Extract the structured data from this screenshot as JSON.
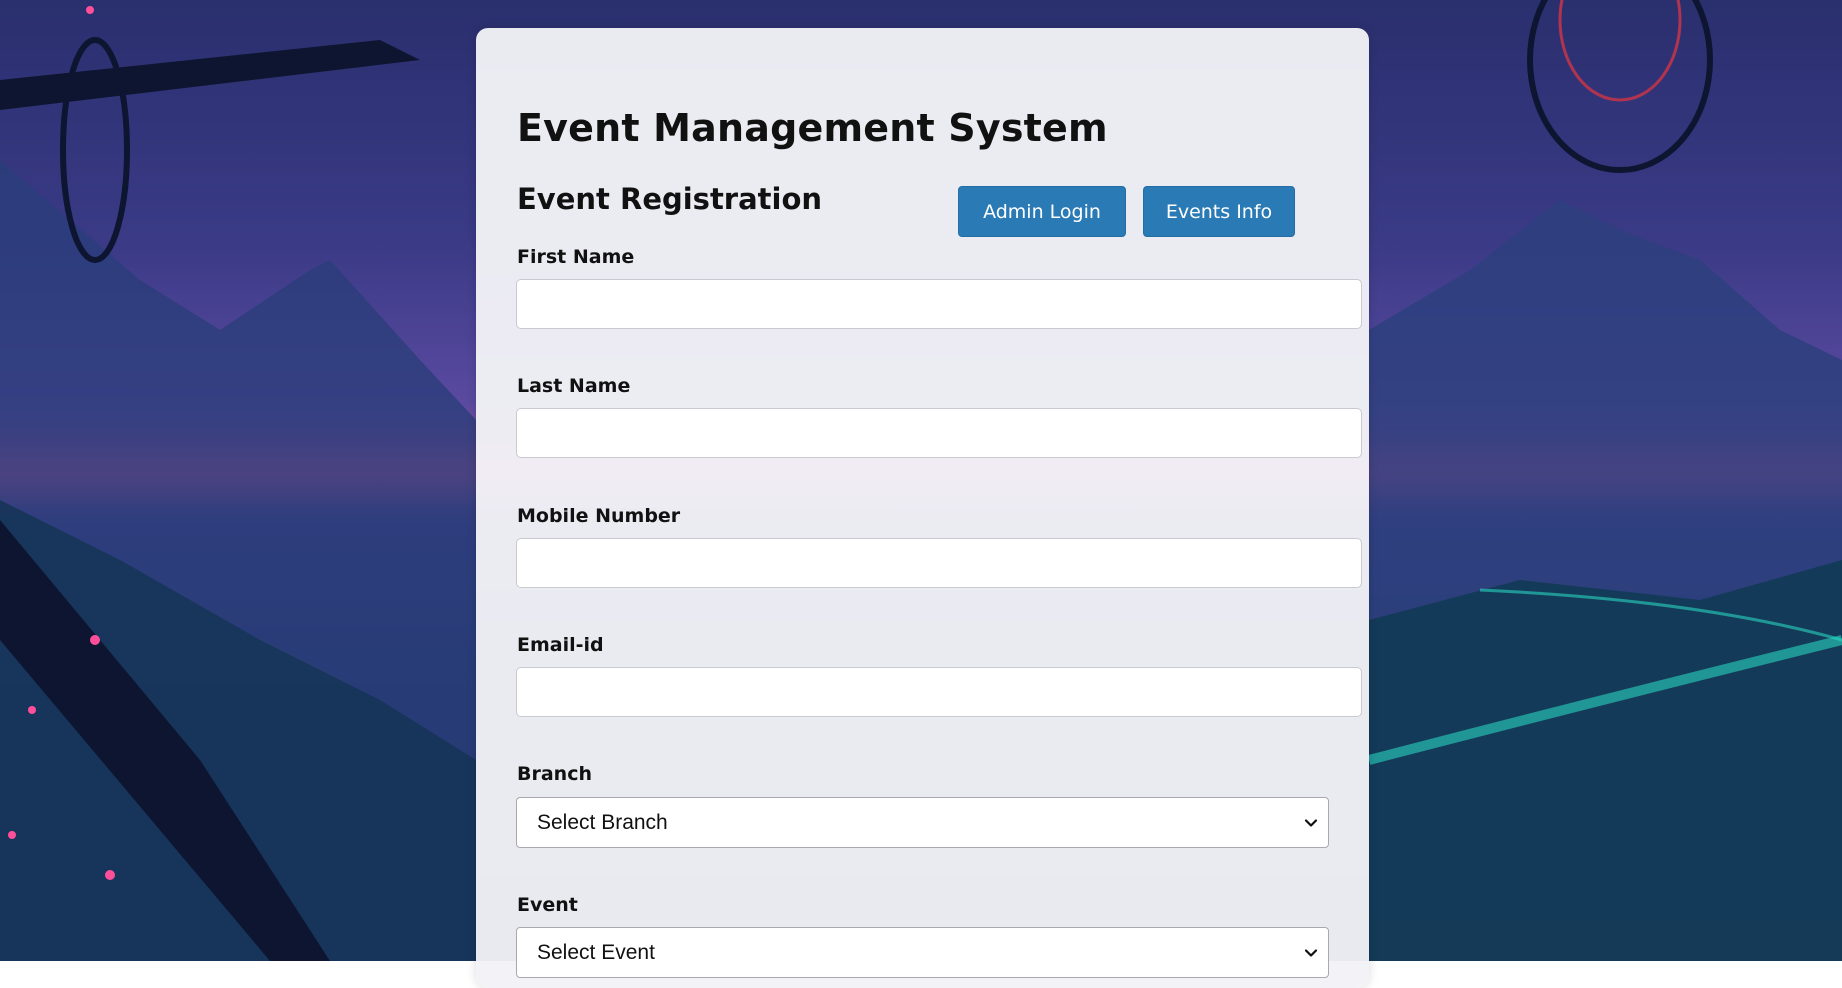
{
  "header": {
    "app_title": "Event Management System",
    "section_title": "Event Registration"
  },
  "buttons": {
    "admin_login": "Admin Login",
    "events_info": "Events Info"
  },
  "form": {
    "first_name": {
      "label": "First Name",
      "value": ""
    },
    "last_name": {
      "label": "Last Name",
      "value": ""
    },
    "mobile_number": {
      "label": "Mobile Number",
      "value": ""
    },
    "email": {
      "label": "Email-id",
      "value": ""
    },
    "branch": {
      "label": "Branch",
      "selected": "Select Branch"
    },
    "event": {
      "label": "Event",
      "selected": "Select Event"
    }
  },
  "colors": {
    "accent": "#2a7ab6",
    "card_background": "#f2f3f7",
    "text": "#111111"
  },
  "icons": {
    "select_chevron": "chevron-down-icon"
  }
}
